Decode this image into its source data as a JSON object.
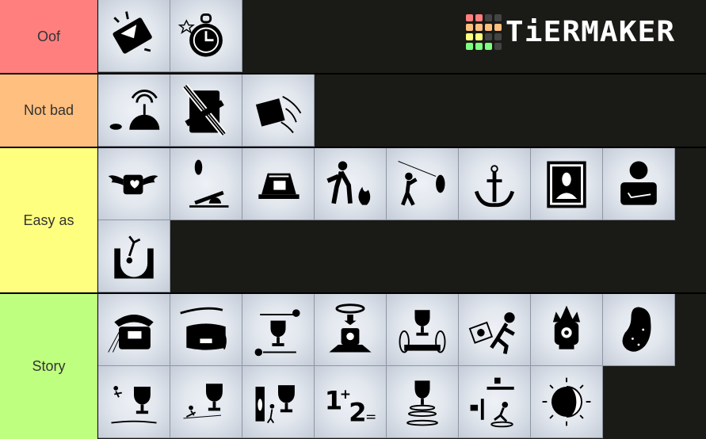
{
  "app": {
    "brand": "TiERMAKER"
  },
  "logo_grid": [
    "#ff7f7f",
    "#ff7f7f",
    "#444444",
    "#444444",
    "#ffbf7f",
    "#ffbf7f",
    "#ffbf7f",
    "#ffbf7f",
    "#ffff7f",
    "#ffff7f",
    "#444444",
    "#444444",
    "#7fff7f",
    "#7fff7f",
    "#7fff7f",
    "#444444"
  ],
  "tiers": [
    {
      "label": "Oof",
      "color": "#ff7f7f",
      "items": [
        {
          "icon": "shattered-panel-icon"
        },
        {
          "icon": "stopwatch-icon"
        }
      ]
    },
    {
      "label": "Not bad",
      "color": "#ffbf7f",
      "items": [
        {
          "icon": "radar-mouse-icon"
        },
        {
          "icon": "crossed-door-icon"
        },
        {
          "icon": "flying-panel-icon"
        }
      ]
    },
    {
      "label": "Easy as",
      "color": "#ffff7f",
      "items": [
        {
          "icon": "winged-companion-cube-icon"
        },
        {
          "icon": "turret-catapult-icon"
        },
        {
          "icon": "bed-radio-icon"
        },
        {
          "icon": "person-fire-icon"
        },
        {
          "icon": "person-turret-laser-icon"
        },
        {
          "icon": "anchor-icon"
        },
        {
          "icon": "framed-portrait-icon"
        },
        {
          "icon": "crossed-arms-person-icon"
        },
        {
          "icon": "falling-person-pit-icon"
        }
      ]
    },
    {
      "label": "Story",
      "color": "#bfff7f",
      "items": [
        {
          "icon": "telephone-icon"
        },
        {
          "icon": "overgrown-panel-icon"
        },
        {
          "icon": "trophy-lasers-icon"
        },
        {
          "icon": "portal-cube-button-icon"
        },
        {
          "icon": "trophy-portals-icon"
        },
        {
          "icon": "person-panel-run-icon"
        },
        {
          "icon": "crowned-core-icon"
        },
        {
          "icon": "potato-icon"
        },
        {
          "icon": "trophy-fling-icon"
        },
        {
          "icon": "trophy-slide-icon"
        },
        {
          "icon": "trophy-door-person-icon"
        },
        {
          "icon": "math-1-plus-2-icon"
        },
        {
          "icon": "trophy-portal-stack-icon"
        },
        {
          "icon": "person-faith-plate-icon"
        },
        {
          "icon": "moon-sun-icon"
        }
      ]
    }
  ]
}
